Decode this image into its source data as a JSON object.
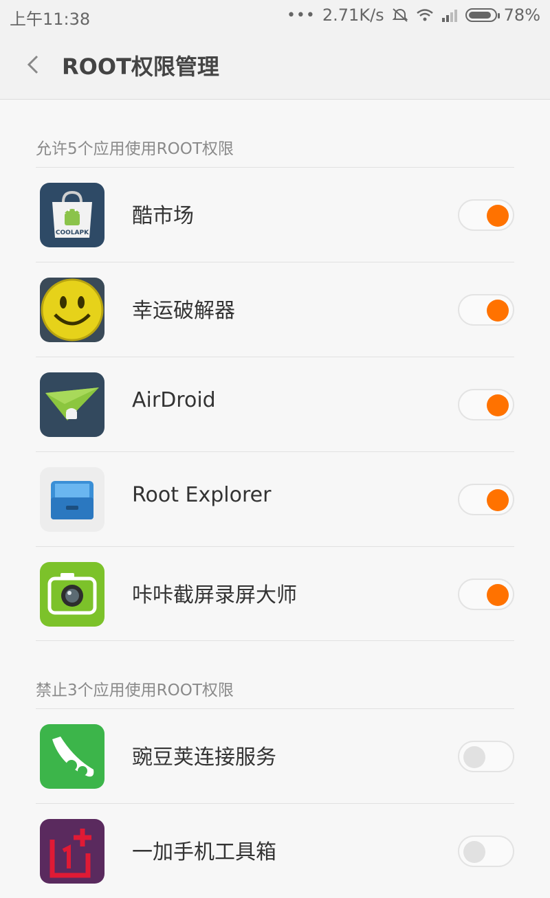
{
  "status_bar": {
    "time": "上午11:38",
    "network_speed": "2.71K/s",
    "battery": "78%",
    "icons": [
      "more-dots-icon",
      "alarm-off-icon",
      "wifi-icon",
      "signal-icon",
      "battery-icon"
    ]
  },
  "header": {
    "title": "ROOT权限管理",
    "back_icon": "chevron-left-icon"
  },
  "allowed_section": {
    "title": "允许5个应用使用ROOT权限",
    "apps": [
      {
        "name": "酷市场",
        "icon": "coolapk-icon",
        "icon_label": "COOLAPK",
        "enabled": true
      },
      {
        "name": "幸运破解器",
        "icon": "lucky-patcher-icon",
        "enabled": true
      },
      {
        "name": "AirDroid",
        "icon": "airdroid-icon",
        "enabled": true
      },
      {
        "name": "Root Explorer",
        "icon": "root-explorer-icon",
        "enabled": true
      },
      {
        "name": "咔咔截屏录屏大师",
        "icon": "screenshot-camera-icon",
        "enabled": true
      }
    ]
  },
  "denied_section": {
    "title": "禁止3个应用使用ROOT权限",
    "apps": [
      {
        "name": "豌豆荚连接服务",
        "icon": "wandoujia-icon",
        "enabled": false
      },
      {
        "name": "一加手机工具箱",
        "icon": "oneplus-toolbox-icon",
        "enabled": false
      }
    ]
  },
  "colors": {
    "toggle_on": "#ff7200",
    "toggle_off": "#e1e1e1",
    "background": "#f7f7f7"
  }
}
